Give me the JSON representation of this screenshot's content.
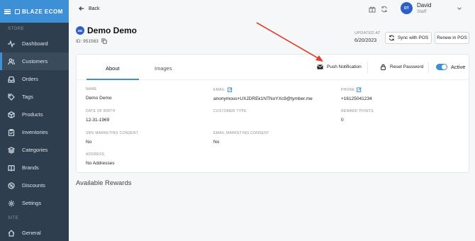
{
  "app": {
    "brand": "BLAZE ECOM"
  },
  "sidebar": {
    "section_store": "STORE",
    "section_site": "SITE",
    "items": [
      {
        "label": "Dashboard",
        "icon": "activity-icon"
      },
      {
        "label": "Customers",
        "icon": "users-icon",
        "active": true
      },
      {
        "label": "Orders",
        "icon": "inbox-icon"
      },
      {
        "label": "Tags",
        "icon": "tag-icon"
      },
      {
        "label": "Products",
        "icon": "box-icon"
      },
      {
        "label": "Inventories",
        "icon": "clipboard-icon"
      },
      {
        "label": "Categories",
        "icon": "layers-icon"
      },
      {
        "label": "Brands",
        "icon": "book-icon"
      },
      {
        "label": "Discounts",
        "icon": "discount-icon"
      },
      {
        "label": "Settings",
        "icon": "gear-icon"
      },
      {
        "label": "General",
        "icon": "home-icon"
      }
    ]
  },
  "topbar": {
    "back_label": "Back",
    "user_initials": "DT",
    "user_name": "David",
    "user_role": "Staff"
  },
  "customer": {
    "initials": "DD",
    "name": "Demo Demo",
    "id_label": "ID: 951563",
    "updated_label": "UPDATED AT",
    "updated_value": "6/20/2023"
  },
  "buttons": {
    "sync": "Sync with POS",
    "renew": "Renew in POS"
  },
  "tabs": {
    "about": "About",
    "images": "Images"
  },
  "actions": {
    "push": "Push Notification",
    "reset": "Reset Password",
    "active": "Active"
  },
  "fields": {
    "name_label": "NAME",
    "name_value": "Demo Demo",
    "email_label": "EMAIL",
    "email_value": "anonymous+UXJDREk1NTNoYXc9@tymber.me",
    "phone_label": "PHONE",
    "phone_value": "+16125041234",
    "dob_label": "DATE OF BIRTH",
    "dob_value": "12-31-1969",
    "type_label": "CUSTOMER TYPE",
    "points_label": "REWARD POINTS",
    "points_value": "0",
    "sms_label": "SMS MARKETING CONSENT",
    "sms_value": "No",
    "emailc_label": "EMAIL MARKETING CONSENT",
    "emailc_value": "No",
    "address_label": "ADDRESS",
    "address_value": "No Addresses"
  },
  "rewards_title": "Available Rewards",
  "colors": {
    "accent": "#3d8fd6",
    "sidebar": "#2f3e4e",
    "arrow": "#e0412b"
  }
}
